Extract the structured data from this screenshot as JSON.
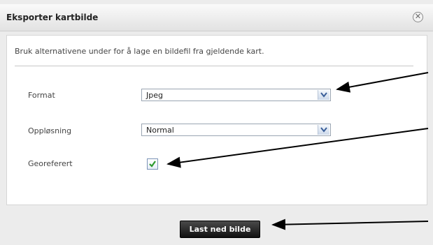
{
  "dialog": {
    "title": "Eksporter kartbilde",
    "close_icon": "close-circle-x",
    "intro": "Bruk alternativene under for å lage en bildefil fra gjeldende kart."
  },
  "form": {
    "format": {
      "label": "Format",
      "value": "Jpeg"
    },
    "resolution": {
      "label": "Oppløsning",
      "value": "Normal"
    },
    "georeferenced": {
      "label": "Georeferert",
      "checked": true
    }
  },
  "footer": {
    "download_label": "Last ned bilde"
  },
  "colors": {
    "button_bg": "#222222",
    "select_border": "#9aa5b2",
    "check_green": "#2e9a2e",
    "annotation_arrow": "#000000"
  },
  "icons": [
    "close-icon",
    "chevron-down-icon",
    "checkmark-icon",
    "annotation-arrow"
  ]
}
